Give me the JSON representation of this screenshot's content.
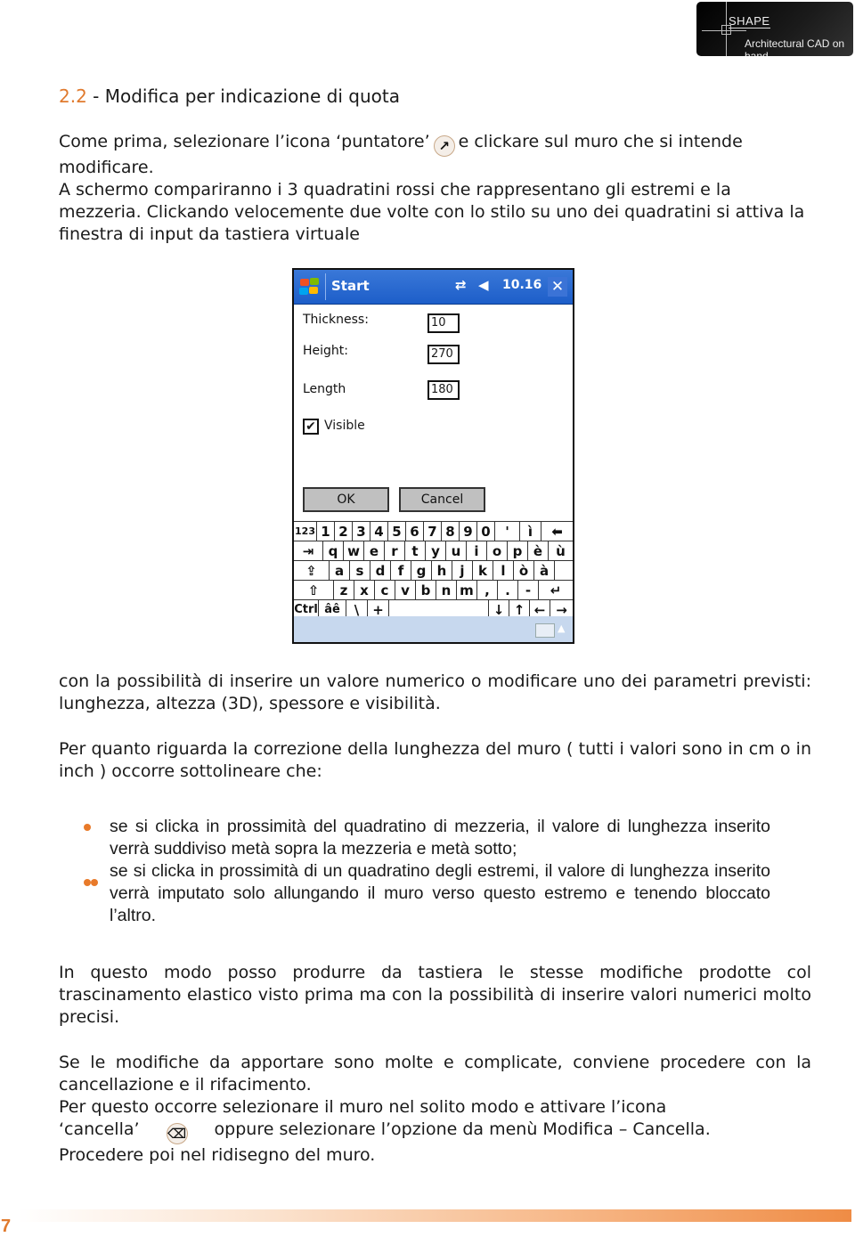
{
  "logo": {
    "name": "SHAPE",
    "tagline": "Architectural CAD on hand"
  },
  "heading": {
    "number": "2.2",
    "title": " - Modifica per indicazione di quota"
  },
  "para1": {
    "before_icon": "Come prima, selezionare l’icona ‘puntatore’",
    "icon": "pointer-arrow-icon",
    "icon_glyph": "↗",
    "after_icon": "e clickare sul muro che si intende modificare.",
    "line2": "A schermo compariranno i 3 quadratini rossi che rappresentano gli estremi e la mezzeria. Clickando velocemente due volte con lo stilo su uno dei quadratini si attiva la finestra di input da tastiera virtuale"
  },
  "device": {
    "taskbar": {
      "start": "Start",
      "connectivity_glyph": "⇄",
      "volume_glyph": "◀",
      "time": "10.16",
      "close": "✕"
    },
    "fields": [
      {
        "label": "Thickness:",
        "value": "10"
      },
      {
        "label": "Height:",
        "value": "270"
      },
      {
        "label": "Length",
        "value": "180"
      }
    ],
    "visible": {
      "label": "Visible",
      "checked": true,
      "glyph": "✔"
    },
    "ok": "OK",
    "cancel": "Cancel",
    "keyboard": {
      "row1": [
        "123",
        "1",
        "2",
        "3",
        "4",
        "5",
        "6",
        "7",
        "8",
        "9",
        "0",
        "'",
        "ì",
        "⬅"
      ],
      "row2": [
        "⇥",
        "q",
        "w",
        "e",
        "r",
        "t",
        "y",
        "u",
        "i",
        "o",
        "p",
        "è",
        "ù"
      ],
      "row3": [
        "⇪",
        "a",
        "s",
        "d",
        "f",
        "g",
        "h",
        "j",
        "k",
        "l",
        "ò",
        "à"
      ],
      "row4": [
        "⇧",
        "z",
        "x",
        "c",
        "v",
        "b",
        "n",
        "m",
        ",",
        ".",
        "-",
        "↵"
      ],
      "row5": [
        "Ctrl",
        "âê",
        "\\",
        "+",
        " ",
        "↓",
        "↑",
        "←",
        "→"
      ]
    },
    "sip_arrow": "▲"
  },
  "para2": "con la possibilità di inserire un valore numerico o modificare uno dei parametri previsti: lunghezza, altezza (3D), spessore e visibilità.",
  "para3": "Per quanto riguarda la correzione della lunghezza del muro ( tutti i valori sono in cm o in inch ) occorre sottolineare che:",
  "bullets": {
    "b1": "se si clicka in prossimità del quadratino di mezzeria, il valore di lunghezza inserito verrà suddiviso metà sopra la mezzeria e metà sotto;",
    "b2": "se si clicka in prossimità di un quadratino degli estremi, il valore di lunghezza inserito verrà imputato solo allungando il muro verso questo estremo e tenendo bloccato l’altro."
  },
  "para4": "In questo modo posso produrre da tastiera le stesse modifiche prodotte col trascinamento elastico visto prima ma con la possibilità di inserire valori numerici molto precisi.",
  "para5": {
    "line1": "Se le modifiche da apportare sono molte e complicate, conviene procedere con la cancellazione e il rifacimento.",
    "line2": "Per questo occorre selezionare il muro nel solito modo e attivare l’icona",
    "before_icon": "‘cancella’",
    "icon_glyph": "⌫",
    "after_icon": "oppure selezionare l’opzione da menù Modifica – Cancella.",
    "line3": "Procedere poi nel ridisegno del muro."
  },
  "footer": {
    "page_number": "7"
  },
  "colors": {
    "accent": "#e07a2e",
    "taskbar": "#1d5ec9"
  }
}
